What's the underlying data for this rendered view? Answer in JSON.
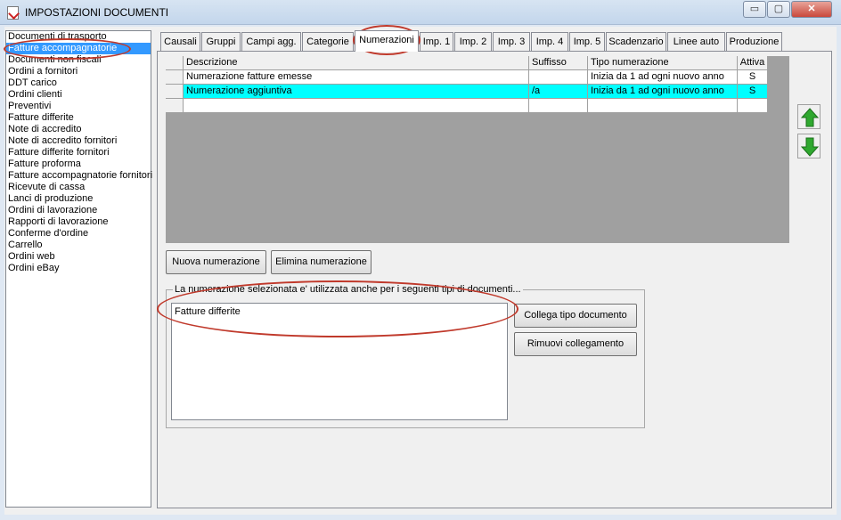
{
  "window": {
    "title": "IMPOSTAZIONI DOCUMENTI",
    "buttons": {
      "minimize": "▭",
      "maximize": "▢",
      "close": "✕"
    }
  },
  "sidebar": {
    "items": [
      "Documenti di trasporto",
      "Fatture accompagnatorie",
      "Documenti non fiscali",
      "Ordini a fornitori",
      "DDT carico",
      "Ordini clienti",
      "Preventivi",
      "Fatture differite",
      "Note di accredito",
      "Note di accredito fornitori",
      "Fatture differite fornitori",
      "Fatture proforma",
      "Fatture accompagnatorie fornitori",
      "Ricevute di cassa",
      "Lanci di produzione",
      "Ordini di lavorazione",
      "Rapporti di lavorazione",
      "Conferme d'ordine",
      "Carrello",
      "Ordini web",
      "Ordini eBay"
    ],
    "selected_index": 1
  },
  "tabs": {
    "items": [
      "Causali",
      "Gruppi",
      "Campi agg.",
      "Categorie",
      "Numerazioni",
      "Imp. 1",
      "Imp. 2",
      "Imp. 3",
      "Imp. 4",
      "Imp. 5",
      "Scadenzario",
      "Linee auto",
      "Produzione"
    ],
    "active_index": 4
  },
  "grid": {
    "columns": [
      "Descrizione",
      "Suffisso",
      "Tipo numerazione",
      "Attiva"
    ],
    "rows": [
      [
        "Numerazione fatture emesse",
        "",
        "Inizia da 1 ad ogni nuovo anno",
        "S"
      ],
      [
        "Numerazione aggiuntiva",
        "/a",
        "Inizia da 1 ad ogni nuovo anno",
        "S"
      ]
    ],
    "selected_row": 1
  },
  "buttons": {
    "new_numbering": "Nuova numerazione",
    "delete_numbering": "Elimina numerazione",
    "link_doc_type": "Collega tipo documento",
    "remove_link": "Rimuovi collegamento"
  },
  "linked": {
    "group_title": "La numerazione selezionata e' utilizzata anche per i seguenti tipi di documenti...",
    "items": [
      "Fatture differite"
    ]
  },
  "colors": {
    "selection_blue": "#3399ff",
    "grid_selected_row": "#00ffff",
    "annotation_red": "#c0392b",
    "arrow_green": "#2fa82f"
  },
  "icons": {
    "move_up": "arrow-up-icon",
    "move_down": "arrow-down-icon",
    "app": "document-check-icon"
  }
}
